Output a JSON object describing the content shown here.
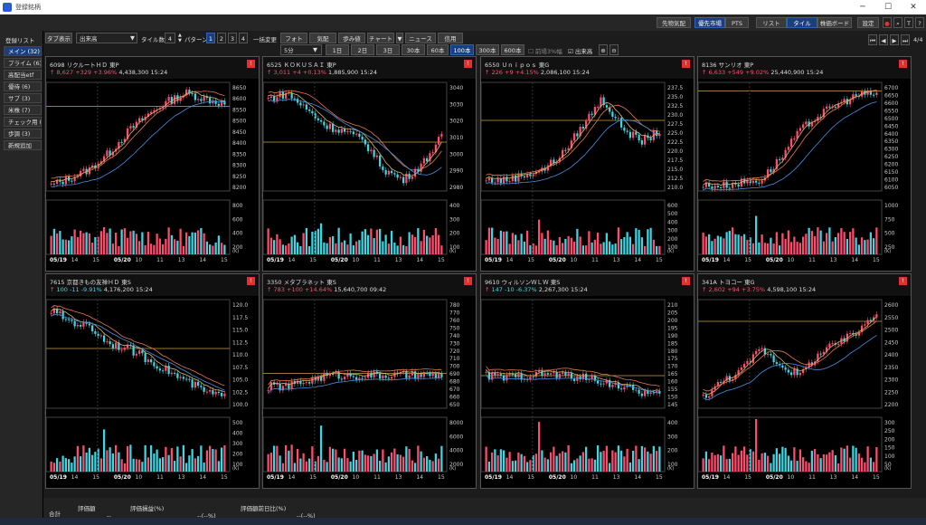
{
  "window": {
    "title": "登録銘柄"
  },
  "toolbar_top": {
    "right_buttons": [
      "先物気配",
      "優先市場",
      "PTS",
      "リスト",
      "タイル",
      "株価ボード",
      "設定"
    ]
  },
  "toolbar_second": {
    "tab_label": "タブ表示",
    "sort_select": "出来高",
    "tile_count_label": "タイル数",
    "tile_count_value": "4",
    "pattern_label": "パターン",
    "pattern_options": [
      "1",
      "2",
      "3",
      "4"
    ],
    "bulk_change_label": "一括変更",
    "view_tabs": [
      "フォト",
      "気配",
      "歩み値",
      "チャート",
      "ニュース",
      "信用"
    ],
    "interval_select": "5分",
    "range_buttons": [
      "1日",
      "2日",
      "3日",
      "30本",
      "60本",
      "100本",
      "300本",
      "600本"
    ],
    "active_range": "100本",
    "checkbox1": "前場3%幅",
    "checkbox2": "出来高",
    "page_indicator": "4/4"
  },
  "sidebar": {
    "header": "登録リスト",
    "items": [
      "メイン (32)",
      "プライム (6)",
      "高配当etf",
      "優待 (6)",
      "サブ (3)",
      "米株 (7)",
      "チェック用 (",
      "歩調 (3)",
      "新規追加"
    ]
  },
  "panels": [
    {
      "code": "6098",
      "name": "リクルートＨＤ",
      "market": "東P",
      "arrow": "↑",
      "price": "8,627",
      "change": "+329 +3.96%",
      "volume": "4,438,300",
      "time": "15:24",
      "dir": "up",
      "yticks": [
        "8650",
        "8600",
        "8550",
        "8500",
        "8450",
        "8400",
        "8350",
        "8300",
        "8250",
        "8200"
      ],
      "vticks": [
        "800",
        "600",
        "400",
        "200"
      ],
      "xticks": [
        "05/19",
        "14",
        "15",
        "05/20",
        "10",
        "11",
        "13",
        "14",
        "15"
      ],
      "pattern": [
        0.05,
        0.12,
        0.2,
        0.35,
        0.55,
        0.7,
        0.82,
        0.9,
        0.85,
        0.8
      ],
      "ref": 0.78
    },
    {
      "code": "6525",
      "name": "ＫＯＫＵＳＡＩ",
      "market": "東P",
      "arrow": "↑",
      "price": "3,011",
      "change": "+4 +0.13%",
      "volume": "1,885,900",
      "time": "15:24",
      "dir": "up",
      "yticks": [
        "3040",
        "3030",
        "3020",
        "3010",
        "3000",
        "2990",
        "2980"
      ],
      "vticks": [
        "400",
        "300",
        "200",
        "100"
      ],
      "xticks": [
        "05/19",
        "14",
        "15",
        "05/20",
        "10",
        "11",
        "13",
        "14",
        "15"
      ],
      "pattern": [
        0.85,
        0.9,
        0.75,
        0.6,
        0.55,
        0.45,
        0.2,
        0.1,
        0.25,
        0.5
      ],
      "ref": 0.45
    },
    {
      "code": "6550",
      "name": "Ｕｎｉｐｏｓ",
      "market": "東G",
      "arrow": "↑",
      "price": "226",
      "change": "+9 +4.15%",
      "volume": "2,086,100",
      "time": "15:24",
      "dir": "up",
      "yticks": [
        "237.5",
        "235.0",
        "232.5",
        "230.0",
        "227.5",
        "225.0",
        "222.5",
        "220.0",
        "217.5",
        "215.0",
        "212.5",
        "210.0"
      ],
      "vticks": [
        "600",
        "500",
        "400",
        "300",
        "200",
        "100"
      ],
      "xticks": [
        "05/19",
        "14",
        "15",
        "05/20",
        "10",
        "11",
        "13",
        "14",
        "15"
      ],
      "pattern": [
        0.1,
        0.1,
        0.15,
        0.2,
        0.35,
        0.6,
        0.85,
        0.6,
        0.45,
        0.55
      ],
      "ref": 0.65
    },
    {
      "code": "8136",
      "name": "サンリオ",
      "market": "東P",
      "arrow": "↑",
      "price": "6,633",
      "change": "+549 +9.02%",
      "volume": "25,440,900",
      "time": "15:24",
      "dir": "up",
      "yticks": [
        "6700",
        "6650",
        "6600",
        "6550",
        "6500",
        "6450",
        "6400",
        "6350",
        "6300",
        "6250",
        "6200",
        "6150",
        "6100",
        "6050"
      ],
      "vticks": [
        "1000",
        "750",
        "500",
        "250"
      ],
      "xticks": [
        "05/19",
        "14",
        "15",
        "05/20",
        "10",
        "11",
        "13",
        "14",
        "15"
      ],
      "pattern": [
        0.05,
        0.05,
        0.08,
        0.1,
        0.3,
        0.55,
        0.7,
        0.8,
        0.88,
        0.9
      ],
      "ref": 0.92
    },
    {
      "code": "7615",
      "name": "京都きもの友禅ＨＤ",
      "market": "東S",
      "arrow": "↑",
      "price": "100",
      "change": "-11 -9.91%",
      "volume": "4,176,200",
      "time": "15:24",
      "dir": "down",
      "yticks": [
        "120.0",
        "117.5",
        "115.0",
        "112.5",
        "110.0",
        "107.5",
        "105.0",
        "102.5",
        "100.0"
      ],
      "vticks": [
        "500",
        "400",
        "300",
        "200",
        "100"
      ],
      "xticks": [
        "05/19",
        "14",
        "15",
        "05/20",
        "10",
        "11",
        "13",
        "14",
        "15"
      ],
      "pattern": [
        0.9,
        0.8,
        0.75,
        0.6,
        0.55,
        0.45,
        0.35,
        0.25,
        0.15,
        0.1
      ],
      "ref": 0.55
    },
    {
      "code": "3350",
      "name": "メタプラネット",
      "market": "東S",
      "arrow": "↑",
      "price": "783",
      "change": "+100 +14.64%",
      "volume": "15,640,700",
      "time": "09:42",
      "dir": "up",
      "yticks": [
        "780",
        "770",
        "760",
        "750",
        "740",
        "730",
        "720",
        "710",
        "700",
        "690",
        "680",
        "670",
        "660",
        "650"
      ],
      "vticks": [
        "8000",
        "6000",
        "4000",
        "2000"
      ],
      "xticks": [
        "05/19",
        "14",
        "15",
        "05/20",
        "10",
        "11",
        "13",
        "14",
        "15"
      ],
      "pattern": [
        0.2,
        0.2,
        0.25,
        0.3,
        0.3,
        0.3,
        0.3,
        0.3,
        0.3,
        0.3
      ],
      "ref": 0.32
    },
    {
      "code": "9610",
      "name": "ウィルソンＷＬＷ",
      "market": "東S",
      "arrow": "↑",
      "price": "147",
      "change": "-10 -6.37%",
      "volume": "2,267,300",
      "time": "15:24",
      "dir": "down",
      "yticks": [
        "210",
        "205",
        "200",
        "195",
        "190",
        "185",
        "180",
        "175",
        "170",
        "165",
        "160",
        "155",
        "150",
        "145"
      ],
      "vticks": [
        "400",
        "300",
        "200",
        "100"
      ],
      "xticks": [
        "05/19",
        "14",
        "15",
        "05/20",
        "10",
        "11",
        "13",
        "14",
        "15"
      ],
      "pattern": [
        0.3,
        0.28,
        0.3,
        0.32,
        0.3,
        0.28,
        0.25,
        0.2,
        0.15,
        0.12
      ],
      "ref": 0.3
    },
    {
      "code": "341A",
      "name": "トヨコー",
      "market": "東G",
      "arrow": "↑",
      "price": "2,602",
      "change": "+94 +3.75%",
      "volume": "4,598,100",
      "time": "15:24",
      "dir": "up",
      "yticks": [
        "2600",
        "2550",
        "2500",
        "2450",
        "2400",
        "2350",
        "2300",
        "2250",
        "2200"
      ],
      "vticks": [
        "300",
        "250",
        "200",
        "150",
        "100",
        "50"
      ],
      "xticks": [
        "05/19",
        "14",
        "15",
        "05/20",
        "10",
        "11",
        "13",
        "14",
        "15"
      ],
      "pattern": [
        0.1,
        0.25,
        0.35,
        0.55,
        0.4,
        0.3,
        0.5,
        0.6,
        0.7,
        0.9
      ],
      "ref": 0.8
    }
  ],
  "bottom": {
    "labels": [
      "合計",
      "評価額",
      "評価損益(%)",
      "評価額前日比(%)"
    ],
    "values": [
      "--",
      "--(--%)",
      "--(--%)"
    ]
  },
  "colors": {
    "up": "#ff4b6e",
    "down": "#3dd6e3",
    "ma1": "#d9b36b",
    "ma2": "#e87a50",
    "ma3": "#4a90e2",
    "ref": "#c8a24a"
  }
}
